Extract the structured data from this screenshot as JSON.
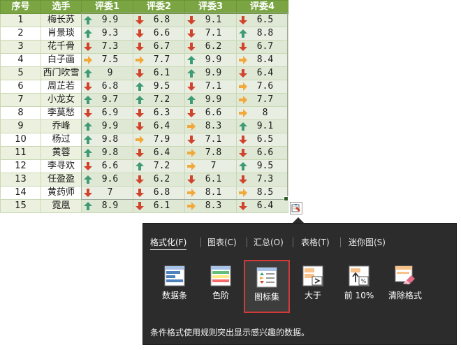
{
  "sheet": {
    "headers": [
      "序号",
      "选手",
      "评委1",
      "评委2",
      "评委3",
      "评委4"
    ],
    "rows": [
      {
        "n": "1",
        "name": "梅长苏",
        "s": [
          {
            "v": "9.9",
            "i": "up"
          },
          {
            "v": "6.8",
            "i": "down"
          },
          {
            "v": "9.1",
            "i": "down"
          },
          {
            "v": "6.5",
            "i": "down"
          }
        ]
      },
      {
        "n": "2",
        "name": "肖景琰",
        "s": [
          {
            "v": "9.3",
            "i": "up"
          },
          {
            "v": "6.6",
            "i": "down"
          },
          {
            "v": "7.1",
            "i": "down"
          },
          {
            "v": "8.8",
            "i": "up"
          }
        ]
      },
      {
        "n": "3",
        "name": "花千骨",
        "s": [
          {
            "v": "7.3",
            "i": "down"
          },
          {
            "v": "6.7",
            "i": "down"
          },
          {
            "v": "6.2",
            "i": "down"
          },
          {
            "v": "6.7",
            "i": "down"
          }
        ]
      },
      {
        "n": "4",
        "name": "白子画",
        "s": [
          {
            "v": "7.5",
            "i": "side"
          },
          {
            "v": "7.7",
            "i": "side"
          },
          {
            "v": "9.9",
            "i": "up"
          },
          {
            "v": "8.4",
            "i": "side"
          }
        ]
      },
      {
        "n": "5",
        "name": "西门吹雪",
        "s": [
          {
            "v": "9",
            "i": "up"
          },
          {
            "v": "6.1",
            "i": "down"
          },
          {
            "v": "9.9",
            "i": "up"
          },
          {
            "v": "6.4",
            "i": "down"
          }
        ]
      },
      {
        "n": "6",
        "name": "周芷若",
        "s": [
          {
            "v": "6.8",
            "i": "down"
          },
          {
            "v": "9.5",
            "i": "up"
          },
          {
            "v": "7.1",
            "i": "down"
          },
          {
            "v": "7.6",
            "i": "side"
          }
        ]
      },
      {
        "n": "7",
        "name": "小龙女",
        "s": [
          {
            "v": "9.7",
            "i": "up"
          },
          {
            "v": "7.2",
            "i": "up"
          },
          {
            "v": "9.9",
            "i": "up"
          },
          {
            "v": "7.7",
            "i": "side"
          }
        ]
      },
      {
        "n": "8",
        "name": "李莫愁",
        "s": [
          {
            "v": "6.9",
            "i": "down"
          },
          {
            "v": "6.3",
            "i": "down"
          },
          {
            "v": "6.6",
            "i": "down"
          },
          {
            "v": "8",
            "i": "side"
          }
        ]
      },
      {
        "n": "9",
        "name": "乔峰",
        "s": [
          {
            "v": "9.9",
            "i": "up"
          },
          {
            "v": "6.4",
            "i": "down"
          },
          {
            "v": "8.3",
            "i": "side"
          },
          {
            "v": "9.1",
            "i": "up"
          }
        ]
      },
      {
        "n": "10",
        "name": "杨过",
        "s": [
          {
            "v": "9.8",
            "i": "up"
          },
          {
            "v": "7.9",
            "i": "side"
          },
          {
            "v": "7.1",
            "i": "down"
          },
          {
            "v": "6.5",
            "i": "down"
          }
        ]
      },
      {
        "n": "11",
        "name": "黄蓉",
        "s": [
          {
            "v": "9.8",
            "i": "up"
          },
          {
            "v": "6.4",
            "i": "down"
          },
          {
            "v": "7.8",
            "i": "side"
          },
          {
            "v": "6.6",
            "i": "down"
          }
        ]
      },
      {
        "n": "12",
        "name": "李寻欢",
        "s": [
          {
            "v": "6.6",
            "i": "down"
          },
          {
            "v": "7.2",
            "i": "up"
          },
          {
            "v": "7",
            "i": "side"
          },
          {
            "v": "9.5",
            "i": "up"
          }
        ]
      },
      {
        "n": "13",
        "name": "任盈盈",
        "s": [
          {
            "v": "9.6",
            "i": "up"
          },
          {
            "v": "6.2",
            "i": "down"
          },
          {
            "v": "6.1",
            "i": "down"
          },
          {
            "v": "7.3",
            "i": "down"
          }
        ]
      },
      {
        "n": "14",
        "name": "黄药师",
        "s": [
          {
            "v": "7",
            "i": "down"
          },
          {
            "v": "6.8",
            "i": "down"
          },
          {
            "v": "8.1",
            "i": "side"
          },
          {
            "v": "8.5",
            "i": "side"
          }
        ]
      },
      {
        "n": "15",
        "name": "霓凰",
        "s": [
          {
            "v": "8.9",
            "i": "up"
          },
          {
            "v": "6.1",
            "i": "down"
          },
          {
            "v": "8.3",
            "i": "side"
          },
          {
            "v": "6.4",
            "i": "down"
          }
        ]
      }
    ]
  },
  "colors": {
    "header_bg": "#7aa542",
    "arrow_up": "#3f9b75",
    "arrow_down": "#d1432c",
    "arrow_side": "#f2a93b",
    "panel_bg": "#2c2c2c",
    "selected_border": "#d23a3a"
  },
  "quick_analysis": {
    "tabs": [
      {
        "label": "格式化(F)",
        "active": true
      },
      {
        "label": "图表(C)",
        "active": false
      },
      {
        "label": "汇总(O)",
        "active": false
      },
      {
        "label": "表格(T)",
        "active": false
      },
      {
        "label": "迷你图(S)",
        "active": false
      }
    ],
    "tiles": [
      {
        "label": "数据条",
        "icon": "data-bars-icon",
        "selected": false
      },
      {
        "label": "色阶",
        "icon": "color-scale-icon",
        "selected": false
      },
      {
        "label": "图标集",
        "icon": "icon-set-icon",
        "selected": true
      },
      {
        "label": "大于",
        "icon": "greater-than-icon",
        "selected": false
      },
      {
        "label": "前 10%",
        "icon": "top-10-percent-icon",
        "selected": false
      },
      {
        "label": "清除格式",
        "icon": "clear-format-icon",
        "selected": false
      }
    ],
    "description": "条件格式使用规则突出显示感兴趣的数据。"
  }
}
